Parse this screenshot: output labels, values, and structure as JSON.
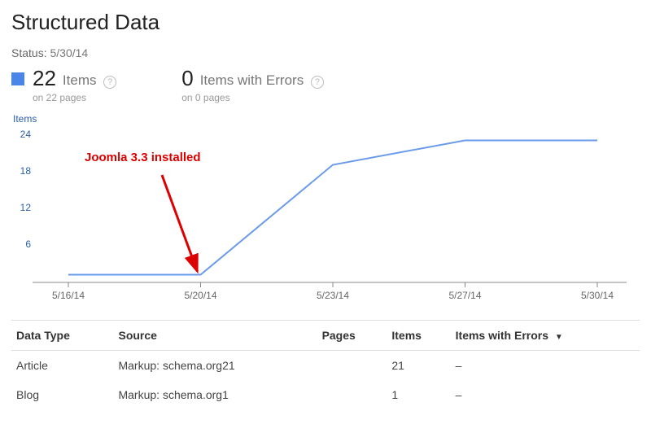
{
  "title": "Structured Data",
  "status_label": "Status:",
  "status_value": "5/30/14",
  "summary": {
    "items_count": "22",
    "items_label": "Items",
    "items_sub": "on 22 pages",
    "errors_count": "0",
    "errors_label": "Items with Errors",
    "errors_sub": "on 0 pages"
  },
  "chart_section_label": "Items",
  "annotation_text": "Joomla 3.3 installed",
  "table": {
    "headers": {
      "datatype": "Data Type",
      "source": "Source",
      "pages": "Pages",
      "items": "Items",
      "errors": "Items with Errors"
    },
    "rows": [
      {
        "datatype": "Article",
        "source": "Markup: schema.org21",
        "pages": "",
        "items": "21",
        "errors": "–"
      },
      {
        "datatype": "Blog",
        "source": "Markup: schema.org1",
        "pages": "",
        "items": "1",
        "errors": "–"
      }
    ]
  },
  "chart_data": {
    "type": "line",
    "title": "Items",
    "xlabel": "",
    "ylabel": "Items",
    "ylim": [
      0,
      24
    ],
    "y_ticks": [
      6,
      12,
      18,
      24
    ],
    "x_ticks": [
      "5/16/14",
      "5/20/14",
      "5/23/14",
      "5/27/14",
      "5/30/14"
    ],
    "categories": [
      "5/16/14",
      "5/20/14",
      "5/23/14",
      "5/27/14",
      "5/30/14"
    ],
    "values": [
      1,
      1,
      19,
      23,
      23
    ],
    "annotation": "Joomla 3.3 installed",
    "annotation_x": "5/20/14"
  }
}
